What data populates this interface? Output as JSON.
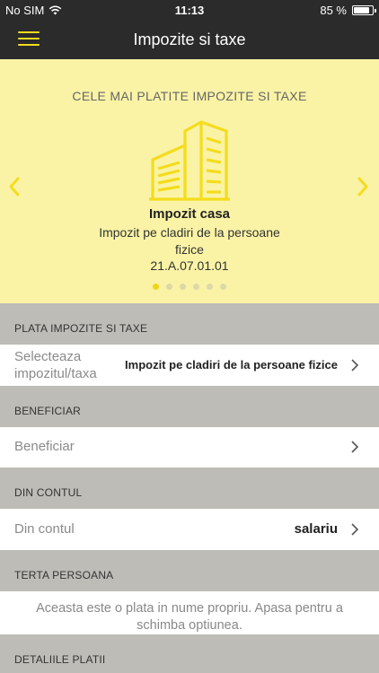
{
  "status": {
    "carrier": "No SIM",
    "time": "11:13",
    "battery_text": "85 %",
    "battery_level": 0.85
  },
  "nav": {
    "title": "Impozite si taxe"
  },
  "carousel": {
    "heading": "CELE MAI PLATITE IMPOZITE SI TAXE",
    "slide_title": "Impozit casa",
    "slide_desc": "Impozit pe cladiri de la persoane fizice",
    "slide_code": "21.A.07.01.01",
    "page_count": 6,
    "active_page": 1,
    "accent_color": "#f4dc1d"
  },
  "sections": {
    "plata": {
      "header": "PLATA IMPOZITE SI TAXE",
      "label": "Selecteaza impozitul/taxa",
      "value": "Impozit pe cladiri de la persoane fizice"
    },
    "beneficiar": {
      "header": "BENEFICIAR",
      "label": "Beneficiar"
    },
    "din_contul": {
      "header": "DIN CONTUL",
      "label": "Din contul",
      "value": "salariu"
    },
    "terta": {
      "header": "TERTA PERSOANA",
      "notice": "Aceasta este o plata in nume propriu. Apasa pentru a schimba optiunea."
    },
    "detalii": {
      "header": "DETALIILE PLATII"
    }
  }
}
